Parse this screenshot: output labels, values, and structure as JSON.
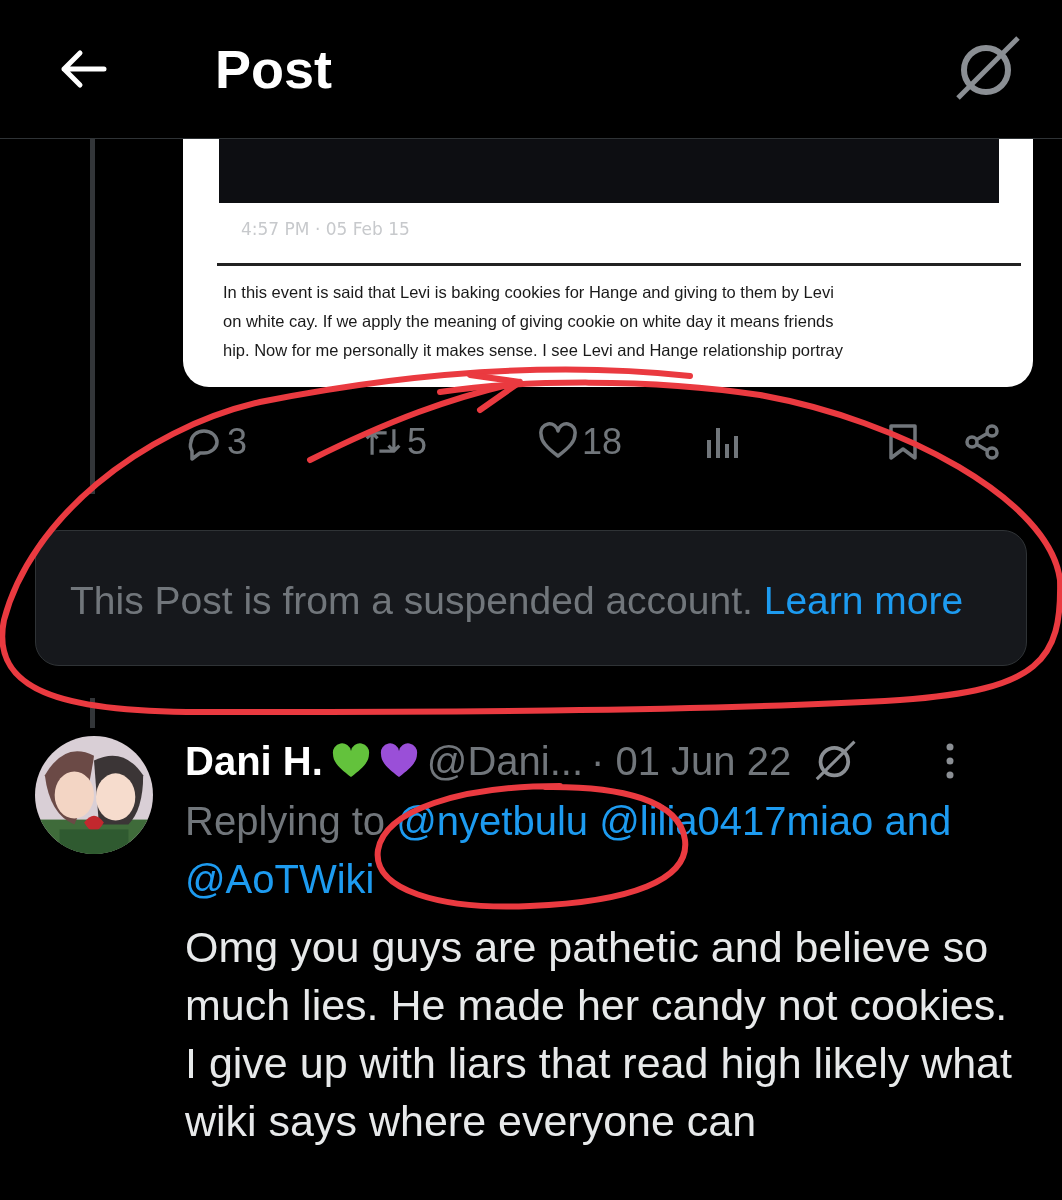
{
  "header": {
    "title": "Post"
  },
  "embedded_image": {
    "timestamp": "4:57 PM · 05 Feb 15",
    "lines": [
      "In this event is said that Levi is baking cookies for Hange and giving to them by Levi",
      "on white cay. If we apply the meaning of giving cookie on white day it means friends",
      "hip. Now for me personally it makes sense. I see Levi and Hange relationship portray"
    ]
  },
  "actions": [
    {
      "kind": "reply",
      "count": "3"
    },
    {
      "kind": "repost",
      "count": "5"
    },
    {
      "kind": "like",
      "count": "18"
    },
    {
      "kind": "views"
    },
    {
      "kind": "bookmark"
    },
    {
      "kind": "share"
    }
  ],
  "notice": {
    "text": "This Post is from a suspended account.",
    "link": "Learn more"
  },
  "reply": {
    "name": "Dani H.",
    "badges": [
      {
        "color": "#63c23c"
      },
      {
        "color": "#9a4fd8"
      }
    ],
    "handle": "@Dani...",
    "date": "· 01 Jun 22",
    "replying_label": "Replying to",
    "mentions": [
      "@nyetbulu",
      "@lilia0417miao"
    ],
    "joiner": "and",
    "last_mention": "@AoTWiki",
    "text": "Omg you guys are pathetic and believe so much lies. He made her candy not cookies. I give up with liars that read high likely what wiki says where everyone can"
  }
}
